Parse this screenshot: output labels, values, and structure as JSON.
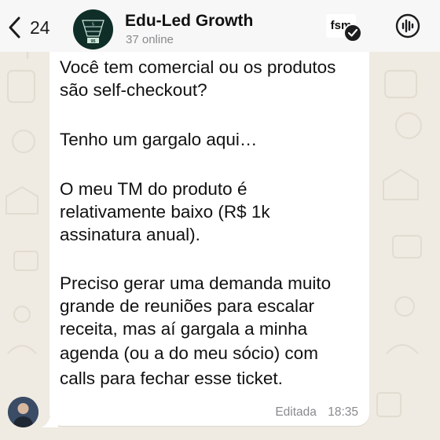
{
  "header": {
    "back_count": "24",
    "group_name": "Edu-Led Growth",
    "online_status": "37 online",
    "group_avatar_digits": {
      "top": "5",
      "bottom": "95"
    },
    "badge_text": "fsm"
  },
  "message": {
    "lines": [
      "Você tem comercial ou os produtos",
      "são self-checkout?",
      "",
      "Tenho um gargalo aqui…",
      "",
      "O meu TM do produto é",
      "relativamente baixo (R$ 1k",
      "assinatura anual).",
      "",
      "Preciso gerar uma demanda muito",
      "grande de reuniões para escalar",
      "receita, mas aí gargala a minha",
      "agenda (ou a do meu sócio) com",
      "calls para fechar esse ticket."
    ],
    "edited_label": "Editada",
    "time": "18:35"
  },
  "colors": {
    "wallpaper": "#efeae2",
    "header_bg": "#f7f7f7",
    "bubble_bg": "#ffffff",
    "group_avatar_bg": "#0f2e27",
    "muted_text": "#8a8a8e"
  },
  "icons": [
    "chevron-left-icon",
    "call-icon",
    "verified-check-icon"
  ]
}
